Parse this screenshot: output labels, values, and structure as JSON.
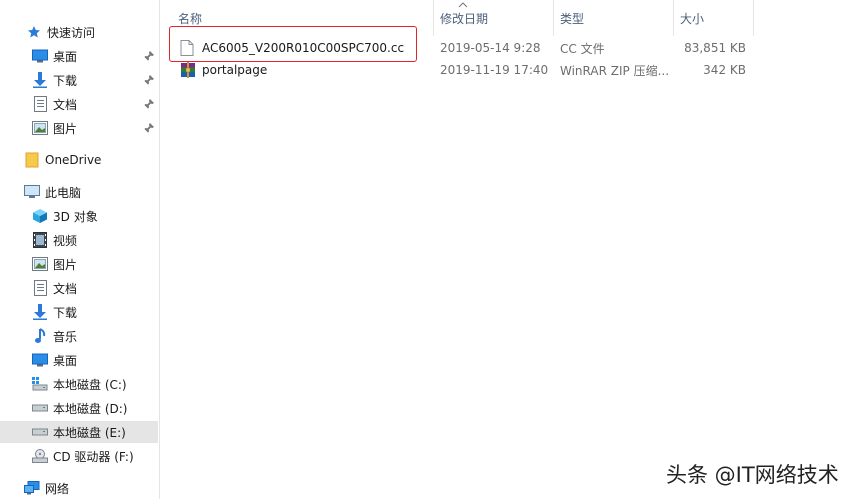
{
  "nav": {
    "quick_access": "快速访问",
    "quick_items": [
      {
        "label": "桌面",
        "icon": "desktop-icon",
        "pinned": true
      },
      {
        "label": "下载",
        "icon": "download-icon",
        "pinned": true
      },
      {
        "label": "文档",
        "icon": "document-icon",
        "pinned": true
      },
      {
        "label": "图片",
        "icon": "pictures-icon",
        "pinned": true
      }
    ],
    "onedrive": "OneDrive",
    "this_pc": "此电脑",
    "pc_items": [
      {
        "label": "3D 对象",
        "icon": "3d-objects-icon"
      },
      {
        "label": "视频",
        "icon": "videos-icon"
      },
      {
        "label": "图片",
        "icon": "pictures-icon"
      },
      {
        "label": "文档",
        "icon": "document-icon"
      },
      {
        "label": "下载",
        "icon": "download-icon"
      },
      {
        "label": "音乐",
        "icon": "music-icon"
      },
      {
        "label": "桌面",
        "icon": "desktop-icon"
      },
      {
        "label": "本地磁盘 (C:)",
        "icon": "system-drive-icon"
      },
      {
        "label": "本地磁盘 (D:)",
        "icon": "drive-icon"
      },
      {
        "label": "本地磁盘 (E:)",
        "icon": "drive-icon",
        "selected": true
      },
      {
        "label": "CD 驱动器 (F:)",
        "icon": "cd-drive-icon"
      }
    ],
    "network": "网络"
  },
  "columns": {
    "name": "名称",
    "date": "修改日期",
    "type": "类型",
    "size": "大小"
  },
  "files": [
    {
      "name": "AC6005_V200R010C00SPC700.cc",
      "date": "2019-05-14 9:28",
      "type": "CC 文件",
      "size": "83,851 KB",
      "icon": "file-icon",
      "highlighted": true
    },
    {
      "name": "portalpage",
      "date": "2019-11-19 17:40",
      "type": "WinRAR ZIP 压缩...",
      "size": "342 KB",
      "icon": "winrar-zip-icon"
    }
  ],
  "watermark": "头条 @IT网络技术",
  "colors": {
    "highlight": "#e0262b",
    "selected_bg": "#e5e5e5",
    "header_text": "#4c607a",
    "folder_yellow": "#f8c94a",
    "blue_icon": "#1e88e5"
  }
}
